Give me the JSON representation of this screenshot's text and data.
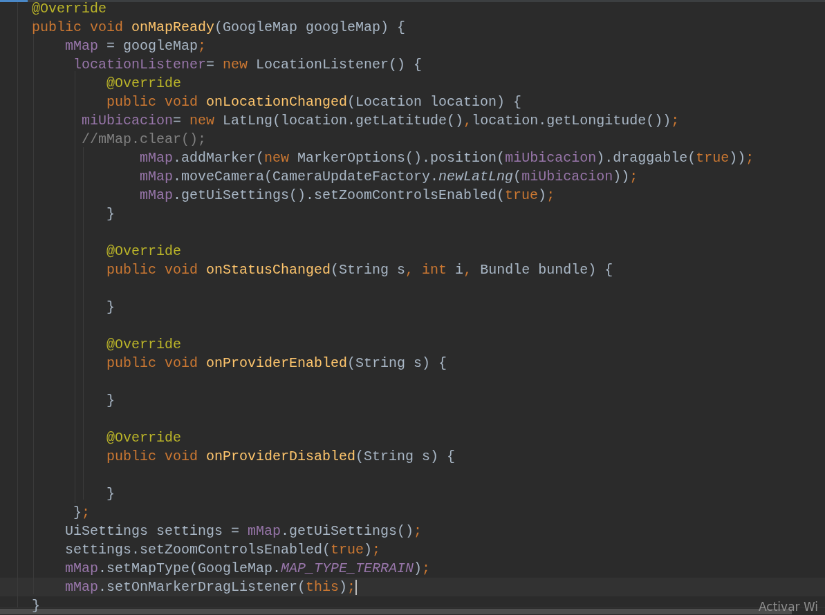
{
  "editor": {
    "lines": [
      {
        "kind": "code",
        "current": false,
        "tokens": [
          {
            "kind": "annotation",
            "text": "@Override"
          }
        ]
      },
      {
        "kind": "code",
        "current": false,
        "tokens": [
          {
            "kind": "keyword",
            "text": "public void "
          },
          {
            "kind": "method",
            "text": "onMapReady"
          },
          {
            "kind": "plain",
            "text": "(GoogleMap googleMap) {"
          }
        ]
      },
      {
        "kind": "code",
        "current": false,
        "tokens": [
          {
            "kind": "field",
            "text": "    mMap"
          },
          {
            "kind": "plain",
            "text": " = googleMap"
          },
          {
            "kind": "keyword",
            "text": ";"
          }
        ]
      },
      {
        "kind": "code",
        "current": false,
        "tokens": [
          {
            "kind": "field",
            "text": "     locationListener"
          },
          {
            "kind": "plain",
            "text": "= "
          },
          {
            "kind": "keyword",
            "text": "new "
          },
          {
            "kind": "plain",
            "text": "LocationListener() {"
          }
        ]
      },
      {
        "kind": "code",
        "current": false,
        "tokens": [
          {
            "kind": "annotation",
            "text": "         @Override"
          }
        ]
      },
      {
        "kind": "code",
        "current": false,
        "tokens": [
          {
            "kind": "keyword",
            "text": "         public void "
          },
          {
            "kind": "method",
            "text": "onLocationChanged"
          },
          {
            "kind": "plain",
            "text": "(Location location) {"
          }
        ]
      },
      {
        "kind": "code",
        "current": false,
        "tokens": [
          {
            "kind": "field",
            "text": "      miUbicacion"
          },
          {
            "kind": "plain",
            "text": "= "
          },
          {
            "kind": "keyword",
            "text": "new "
          },
          {
            "kind": "plain",
            "text": "LatLng(location.getLatitude()"
          },
          {
            "kind": "keyword",
            "text": ","
          },
          {
            "kind": "plain",
            "text": "location.getLongitude())"
          },
          {
            "kind": "keyword",
            "text": ";"
          }
        ]
      },
      {
        "kind": "code",
        "current": false,
        "tokens": [
          {
            "kind": "comment",
            "text": "      //mMap.clear();"
          }
        ]
      },
      {
        "kind": "code",
        "current": false,
        "tokens": [
          {
            "kind": "field",
            "text": "             mMap"
          },
          {
            "kind": "plain",
            "text": ".addMarker("
          },
          {
            "kind": "keyword",
            "text": "new "
          },
          {
            "kind": "plain",
            "text": "MarkerOptions().position("
          },
          {
            "kind": "field",
            "text": "miUbicacion"
          },
          {
            "kind": "plain",
            "text": ").draggable("
          },
          {
            "kind": "keyword",
            "text": "true"
          },
          {
            "kind": "plain",
            "text": "))"
          },
          {
            "kind": "keyword",
            "text": ";"
          }
        ]
      },
      {
        "kind": "code",
        "current": false,
        "tokens": [
          {
            "kind": "field",
            "text": "             mMap"
          },
          {
            "kind": "plain",
            "text": ".moveCamera(CameraUpdateFactory."
          },
          {
            "kind": "static-method",
            "text": "newLatLng"
          },
          {
            "kind": "plain",
            "text": "("
          },
          {
            "kind": "field",
            "text": "miUbicacion"
          },
          {
            "kind": "plain",
            "text": "))"
          },
          {
            "kind": "keyword",
            "text": ";"
          }
        ]
      },
      {
        "kind": "code",
        "current": false,
        "tokens": [
          {
            "kind": "field",
            "text": "             mMap"
          },
          {
            "kind": "plain",
            "text": ".getUiSettings().setZoomControlsEnabled("
          },
          {
            "kind": "keyword",
            "text": "true"
          },
          {
            "kind": "plain",
            "text": ")"
          },
          {
            "kind": "keyword",
            "text": ";"
          }
        ]
      },
      {
        "kind": "code",
        "current": false,
        "tokens": [
          {
            "kind": "plain",
            "text": "         }"
          }
        ]
      },
      {
        "kind": "blank",
        "current": false
      },
      {
        "kind": "code",
        "current": false,
        "tokens": [
          {
            "kind": "annotation",
            "text": "         @Override"
          }
        ]
      },
      {
        "kind": "code",
        "current": false,
        "tokens": [
          {
            "kind": "keyword",
            "text": "         public void "
          },
          {
            "kind": "method",
            "text": "onStatusChanged"
          },
          {
            "kind": "plain",
            "text": "(String s"
          },
          {
            "kind": "keyword",
            "text": ", int "
          },
          {
            "kind": "plain",
            "text": "i"
          },
          {
            "kind": "keyword",
            "text": ", "
          },
          {
            "kind": "plain",
            "text": "Bundle bundle) {"
          }
        ]
      },
      {
        "kind": "blank",
        "current": false
      },
      {
        "kind": "code",
        "current": false,
        "tokens": [
          {
            "kind": "plain",
            "text": "         }"
          }
        ]
      },
      {
        "kind": "blank",
        "current": false
      },
      {
        "kind": "code",
        "current": false,
        "tokens": [
          {
            "kind": "annotation",
            "text": "         @Override"
          }
        ]
      },
      {
        "kind": "code",
        "current": false,
        "tokens": [
          {
            "kind": "keyword",
            "text": "         public void "
          },
          {
            "kind": "method",
            "text": "onProviderEnabled"
          },
          {
            "kind": "plain",
            "text": "(String s) {"
          }
        ]
      },
      {
        "kind": "blank",
        "current": false
      },
      {
        "kind": "code",
        "current": false,
        "tokens": [
          {
            "kind": "plain",
            "text": "         }"
          }
        ]
      },
      {
        "kind": "blank",
        "current": false
      },
      {
        "kind": "code",
        "current": false,
        "tokens": [
          {
            "kind": "annotation",
            "text": "         @Override"
          }
        ]
      },
      {
        "kind": "code",
        "current": false,
        "tokens": [
          {
            "kind": "keyword",
            "text": "         public void "
          },
          {
            "kind": "method",
            "text": "onProviderDisabled"
          },
          {
            "kind": "plain",
            "text": "(String s) {"
          }
        ]
      },
      {
        "kind": "blank",
        "current": false
      },
      {
        "kind": "code",
        "current": false,
        "tokens": [
          {
            "kind": "plain",
            "text": "         }"
          }
        ]
      },
      {
        "kind": "code",
        "current": false,
        "tokens": [
          {
            "kind": "plain",
            "text": "     }"
          },
          {
            "kind": "keyword",
            "text": ";"
          }
        ]
      },
      {
        "kind": "code",
        "current": false,
        "tokens": [
          {
            "kind": "plain",
            "text": "    UiSettings settings = "
          },
          {
            "kind": "field",
            "text": "mMap"
          },
          {
            "kind": "plain",
            "text": ".getUiSettings()"
          },
          {
            "kind": "keyword",
            "text": ";"
          }
        ]
      },
      {
        "kind": "code",
        "current": false,
        "tokens": [
          {
            "kind": "plain",
            "text": "    settings.setZoomControlsEnabled("
          },
          {
            "kind": "keyword",
            "text": "true"
          },
          {
            "kind": "plain",
            "text": ")"
          },
          {
            "kind": "keyword",
            "text": ";"
          }
        ]
      },
      {
        "kind": "code",
        "current": false,
        "tokens": [
          {
            "kind": "field",
            "text": "    mMap"
          },
          {
            "kind": "plain",
            "text": ".setMapType(GoogleMap."
          },
          {
            "kind": "static-field",
            "text": "MAP_TYPE_TERRAIN"
          },
          {
            "kind": "plain",
            "text": ")"
          },
          {
            "kind": "keyword",
            "text": ";"
          }
        ]
      },
      {
        "kind": "code",
        "current": true,
        "tokens": [
          {
            "kind": "field",
            "text": "    mMap"
          },
          {
            "kind": "plain",
            "text": ".setOnMarkerDragListener("
          },
          {
            "kind": "keyword",
            "text": "this"
          },
          {
            "kind": "plain",
            "text": ")"
          },
          {
            "kind": "keyword",
            "text": ";"
          }
        ]
      },
      {
        "kind": "code",
        "current": false,
        "tokens": [
          {
            "kind": "plain",
            "text": "}"
          }
        ]
      }
    ]
  },
  "os_notice": "Activar Wi"
}
